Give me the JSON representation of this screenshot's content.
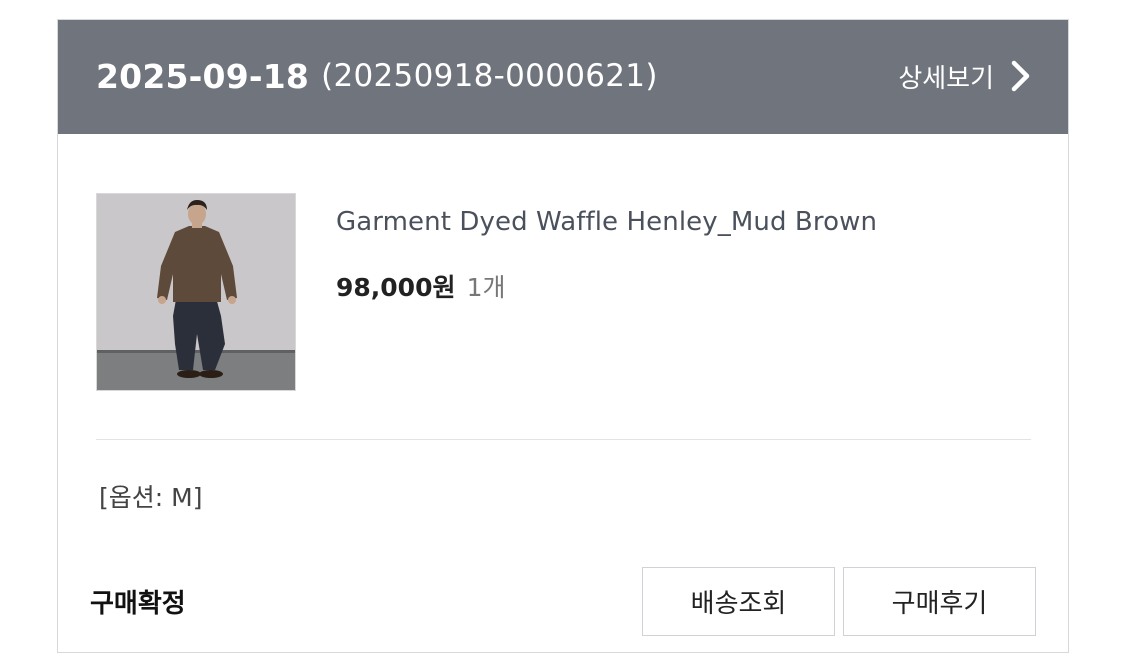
{
  "order": {
    "date": "2025-09-18",
    "number": "(20250918-0000621)",
    "detail_label": "상세보기"
  },
  "item": {
    "name": "Garment Dyed Waffle Henley_Mud Brown",
    "price": "98,000원",
    "quantity": "1개",
    "option": "[옵션: M]"
  },
  "status": "구매확정",
  "buttons": {
    "tracking": "배송조회",
    "review": "구매후기"
  },
  "colors": {
    "header_bg": "#6f747d",
    "header_text": "#ffffff",
    "product_name": "#4b515c",
    "border": "#d6d8dc"
  },
  "icons": {
    "detail": "chevron-right-icon",
    "thumbnail": "product-photo"
  }
}
